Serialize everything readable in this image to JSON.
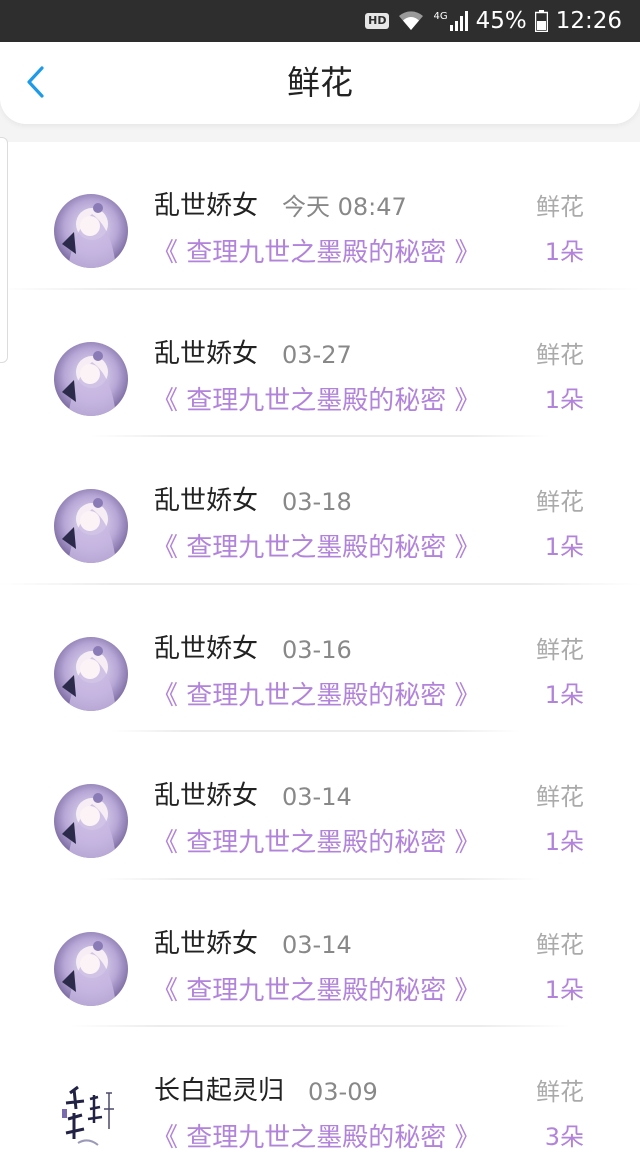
{
  "status_bar": {
    "hd": "HD",
    "network": "4G",
    "battery": "45%",
    "time": "12:26"
  },
  "header": {
    "title": "鲜花"
  },
  "items": [
    {
      "user": "乱世娇女",
      "time": "今天 08:47",
      "book": "《 查理九世之墨殿的秘密 》",
      "gift": "鲜花",
      "count": "1朵"
    },
    {
      "user": "乱世娇女",
      "time": "03-27",
      "book": "《 查理九世之墨殿的秘密 》",
      "gift": "鲜花",
      "count": "1朵"
    },
    {
      "user": "乱世娇女",
      "time": "03-18",
      "book": "《 查理九世之墨殿的秘密 》",
      "gift": "鲜花",
      "count": "1朵"
    },
    {
      "user": "乱世娇女",
      "time": "03-16",
      "book": "《 查理九世之墨殿的秘密 》",
      "gift": "鲜花",
      "count": "1朵"
    },
    {
      "user": "乱世娇女",
      "time": "03-14",
      "book": "《 查理九世之墨殿的秘密 》",
      "gift": "鲜花",
      "count": "1朵"
    },
    {
      "user": "乱世娇女",
      "time": "03-14",
      "book": "《 查理九世之墨殿的秘密 》",
      "gift": "鲜花",
      "count": "1朵"
    },
    {
      "user": "长白起灵归",
      "time": "03-09",
      "book": "《 查理九世之墨殿的秘密 》",
      "gift": "鲜花",
      "count": "3朵"
    }
  ],
  "colors": {
    "accent": "#b283da",
    "back_arrow": "#1e9be8"
  }
}
